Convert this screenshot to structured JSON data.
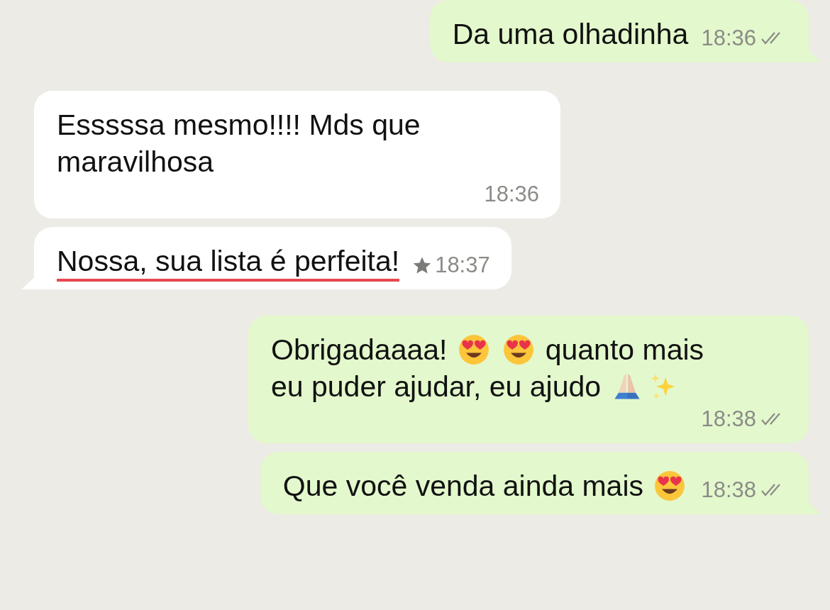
{
  "messages": [
    {
      "outgoing": true,
      "tail": true,
      "parts": [
        {
          "kind": "text",
          "text": "Da uma olhadinha"
        }
      ],
      "time": "18:36",
      "read": false,
      "starred": false,
      "underlined": false
    },
    {
      "outgoing": false,
      "tail": false,
      "parts": [
        {
          "kind": "text",
          "text": "Esssssa mesmo!!!! Mds que maravilhosa"
        }
      ],
      "time": "18:36",
      "starred": false,
      "underlined": false
    },
    {
      "outgoing": false,
      "tail": true,
      "parts": [
        {
          "kind": "text",
          "text": "Nossa, sua lista é perfeita!"
        }
      ],
      "time": "18:37",
      "starred": true,
      "underlined": true
    },
    {
      "outgoing": true,
      "tail": false,
      "parts": [
        {
          "kind": "text",
          "text": "Obrigadaaaa!"
        },
        {
          "kind": "hearteyes"
        },
        {
          "kind": "hearteyes"
        },
        {
          "kind": "text",
          "text": "quanto mais"
        },
        {
          "kind": "text",
          "text": "eu puder ajudar, eu ajudo"
        },
        {
          "kind": "pray"
        },
        {
          "kind": "sparkles"
        }
      ],
      "time": "18:38",
      "read": false,
      "starred": false,
      "underlined": false
    },
    {
      "outgoing": true,
      "tail": true,
      "parts": [
        {
          "kind": "text",
          "text": "Que você venda ainda mais"
        },
        {
          "kind": "hearteyes"
        }
      ],
      "time": "18:38",
      "read": false,
      "starred": false,
      "underlined": false
    }
  ]
}
